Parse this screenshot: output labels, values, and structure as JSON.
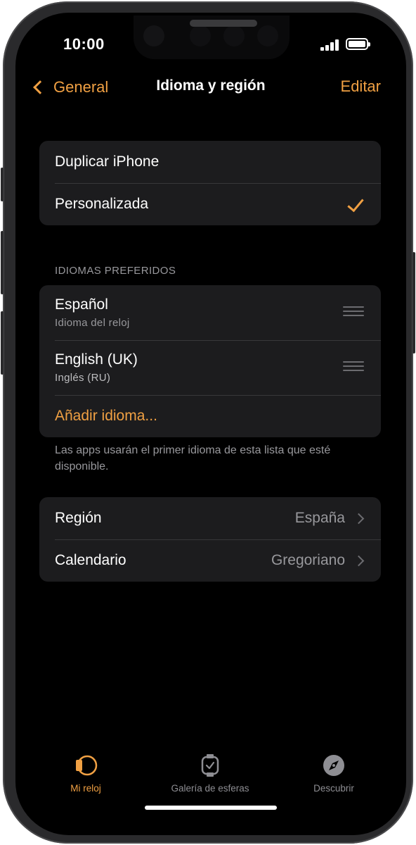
{
  "status_bar": {
    "time": "10:00"
  },
  "nav": {
    "back_label": "General",
    "title": "Idioma y región",
    "edit_label": "Editar"
  },
  "language_mode": {
    "options": [
      {
        "label": "Duplicar iPhone"
      },
      {
        "label": "Personalizada",
        "selected": true
      }
    ]
  },
  "preferred_languages": {
    "header": "IDIOMAS PREFERIDOS",
    "items": [
      {
        "name": "Español",
        "subtitle": "Idioma del reloj"
      },
      {
        "name": "English (UK)",
        "subtitle": "Inglés (RU)"
      }
    ],
    "add_label": "Añadir idioma...",
    "footer": "Las apps usarán el primer idioma de esta lista que esté disponible."
  },
  "region_settings": {
    "items": [
      {
        "label": "Región",
        "value": "España"
      },
      {
        "label": "Calendario",
        "value": "Gregoriano"
      }
    ]
  },
  "tab_bar": {
    "tabs": [
      {
        "label": "Mi reloj",
        "icon": "watch-icon",
        "active": true
      },
      {
        "label": "Galería de esferas",
        "icon": "watch-face-icon"
      },
      {
        "label": "Descubrir",
        "icon": "compass-icon"
      }
    ]
  },
  "colors": {
    "accent": "#f0a043",
    "background": "#000000",
    "group_background": "#1c1c1e",
    "secondary_text": "#98989c"
  }
}
